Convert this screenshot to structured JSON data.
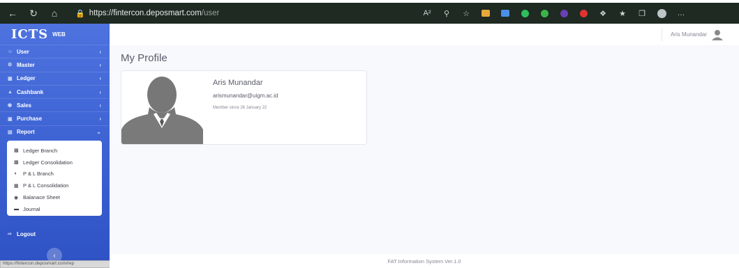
{
  "browser": {
    "url_host": "https://fintercon.deposmart.com",
    "url_path": "/user"
  },
  "brand": {
    "main": "ICTS",
    "sub": "WEB"
  },
  "sidebar": {
    "items": [
      {
        "label": "User",
        "icon": "user-icon"
      },
      {
        "label": "Master",
        "icon": "gear-icon"
      },
      {
        "label": "Ledger",
        "icon": "table-icon"
      },
      {
        "label": "Cashbank",
        "icon": "bank-icon"
      },
      {
        "label": "Sales",
        "icon": "cart-icon"
      },
      {
        "label": "Purchase",
        "icon": "truck-icon"
      },
      {
        "label": "Report",
        "icon": "report-icon"
      }
    ],
    "report_submenu": [
      {
        "label": "Ledger Branch",
        "icon": "book-icon"
      },
      {
        "label": "Ledger Consolidation",
        "icon": "book-icon"
      },
      {
        "label": "P & L Branch",
        "icon": "chart-icon"
      },
      {
        "label": "P & L Consolidation",
        "icon": "chart-icon"
      },
      {
        "label": "Balanace Sheet",
        "icon": "balance-icon"
      },
      {
        "label": "Journal",
        "icon": "journal-icon"
      }
    ],
    "logout_label": "Logout"
  },
  "topbar": {
    "user_name": "Aris Munandar"
  },
  "page": {
    "title": "My Profile"
  },
  "profile": {
    "name": "Aris Munandar",
    "email": "arismunandar@uigm.ac.id",
    "member_since": "Member since 26 January 22"
  },
  "footer": {
    "text": "FAT Information System Ver.1.0"
  },
  "status_tip": "https://fintercon.deposmart.com/rep",
  "colors": {
    "sidebar": "#4e73df",
    "browser_bar": "#1e2a22"
  }
}
